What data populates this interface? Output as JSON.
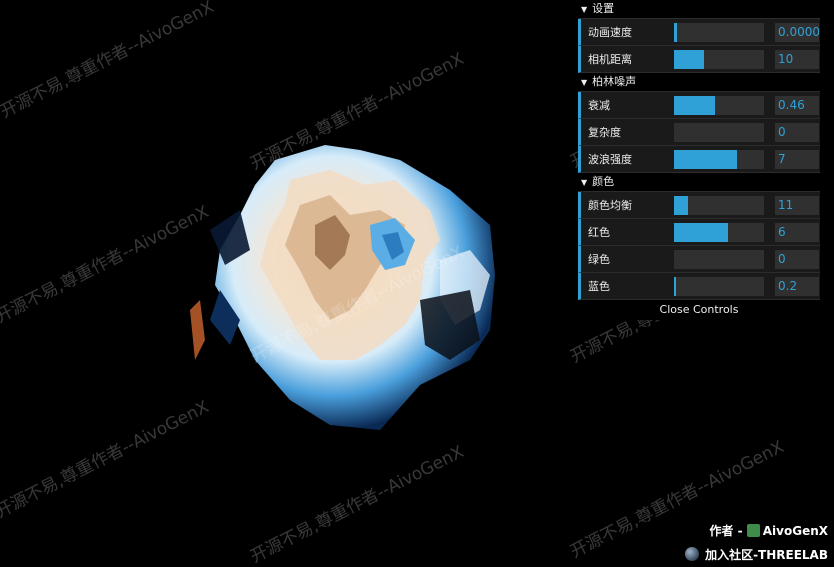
{
  "gui": {
    "folders": [
      {
        "title": "设置",
        "controls": [
          {
            "label": "动画速度",
            "value": "0.0000",
            "fill": 0.03
          },
          {
            "label": "相机距离",
            "value": "10",
            "fill": 0.33
          }
        ]
      },
      {
        "title": "柏林噪声",
        "controls": [
          {
            "label": "衰减",
            "value": "0.46",
            "fill": 0.46
          },
          {
            "label": "复杂度",
            "value": "0",
            "fill": 0
          },
          {
            "label": "波浪强度",
            "value": "7",
            "fill": 0.7
          }
        ]
      },
      {
        "title": "颜色",
        "controls": [
          {
            "label": "颜色均衡",
            "value": "11",
            "fill": 0.16
          },
          {
            "label": "红色",
            "value": "6",
            "fill": 0.6
          },
          {
            "label": "绿色",
            "value": "0",
            "fill": 0
          },
          {
            "label": "蓝色",
            "value": "0.2",
            "fill": 0.02
          }
        ]
      }
    ],
    "close_label": "Close Controls",
    "accent": "#2fa1d6"
  },
  "watermark": {
    "text": "开源不易,尊重作者--AivoGenX"
  },
  "credits": {
    "author": "作者 -",
    "author_name": "AivoGenX",
    "community": "加入社区-THREELAB"
  }
}
